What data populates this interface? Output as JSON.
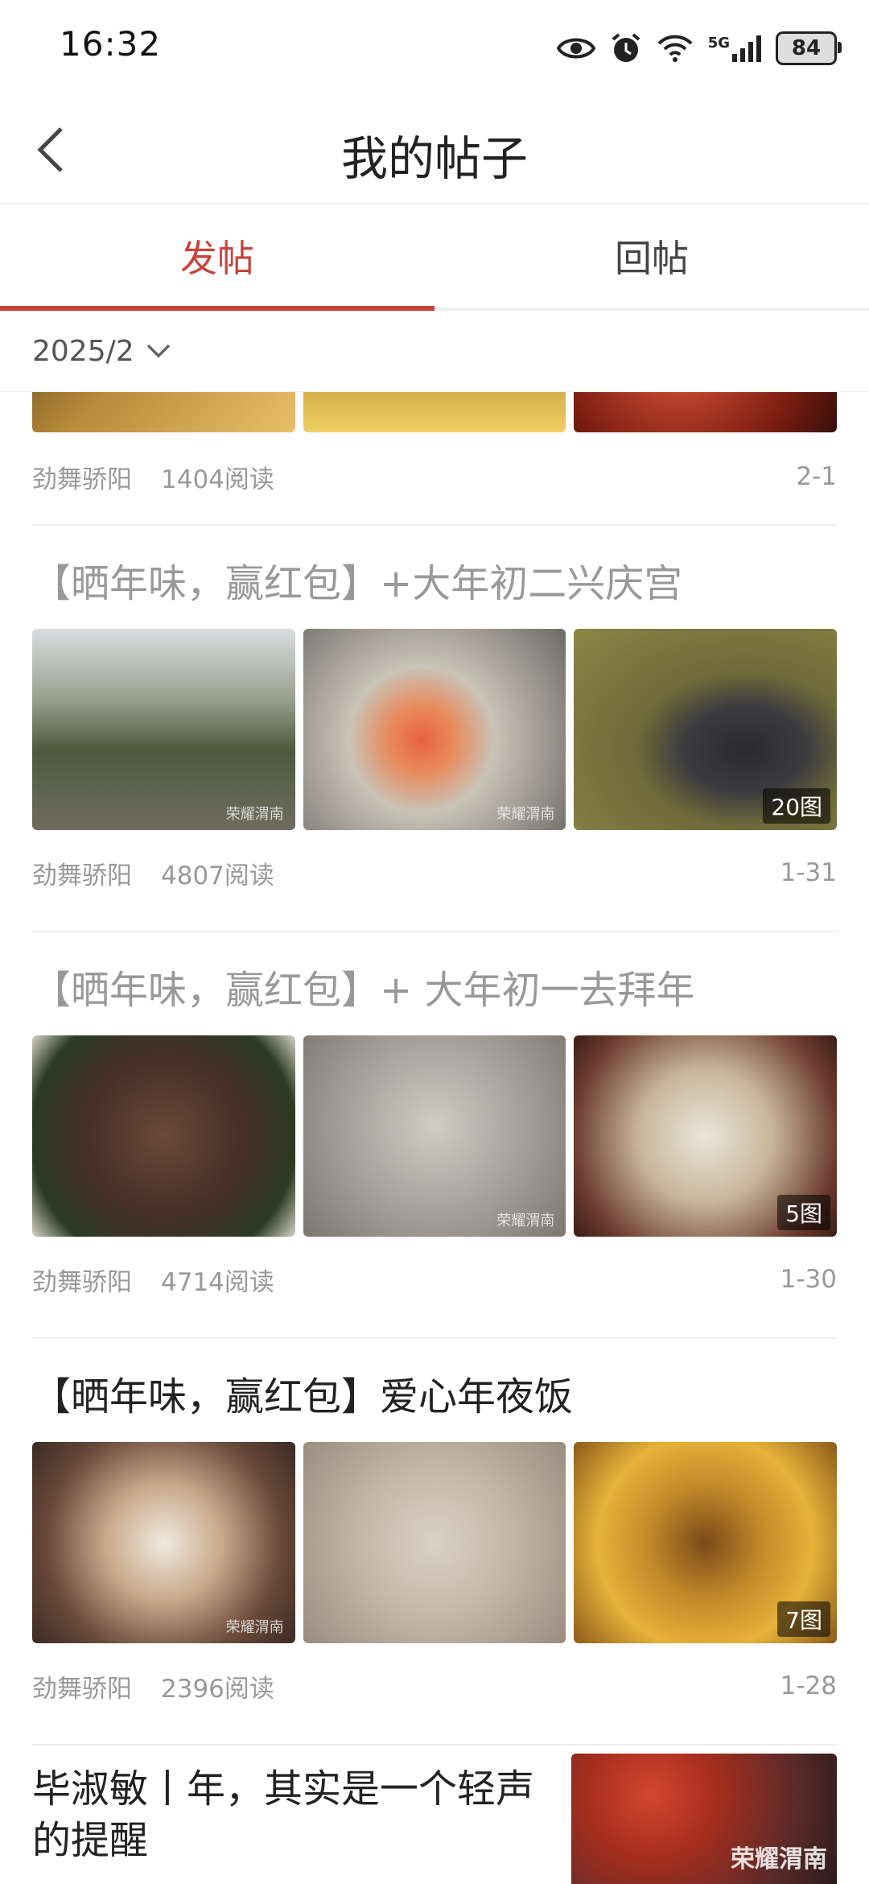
{
  "status": {
    "time": "16:32",
    "network": "5G",
    "battery": "84"
  },
  "header": {
    "title": "我的帖子"
  },
  "tabs": [
    {
      "label": "发帖"
    },
    {
      "label": "回帖"
    }
  ],
  "filter": {
    "label": "2025/2"
  },
  "posts": [
    {
      "author": "劲舞骄阳",
      "reads": "1404阅读",
      "date": "2-1"
    },
    {
      "title": "【晒年味，赢红包】+大年初二兴庆宫",
      "author": "劲舞骄阳",
      "reads": "4807阅读",
      "date": "1-31",
      "image_count": "20图"
    },
    {
      "title": "【晒年味，赢红包】+  大年初一去拜年",
      "author": "劲舞骄阳",
      "reads": "4714阅读",
      "date": "1-30",
      "image_count": "5图"
    },
    {
      "title": "【晒年味，赢红包】爱心年夜饭",
      "author": "劲舞骄阳",
      "reads": "2396阅读",
      "date": "1-28",
      "image_count": "7图"
    },
    {
      "title_line1": "毕淑敏丨年，其实是一个轻声",
      "title_line2": "的提醒"
    }
  ],
  "watermarks": {
    "short": "荣耀渭南",
    "logo": "荣耀渭南"
  },
  "colors": {
    "accent": "#c8443a"
  }
}
